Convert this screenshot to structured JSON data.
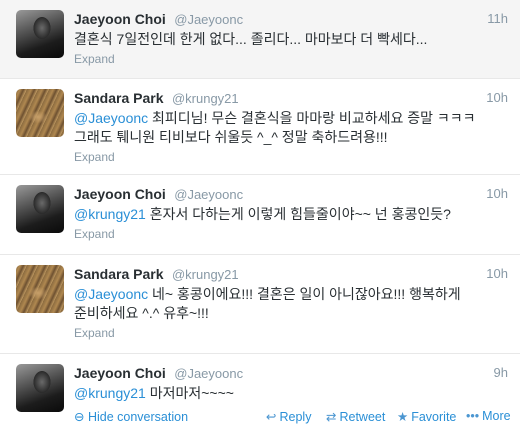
{
  "tweets": [
    {
      "name": "Jaeyoon Choi",
      "handle": "@Jaeyoonc",
      "time": "11h",
      "mention": "",
      "text": "결혼식 7일전인데 한게 없다... 졸리다... 마마보다 더 빡세다...",
      "expand": "Expand"
    },
    {
      "name": "Sandara Park",
      "handle": "@krungy21",
      "time": "10h",
      "mention": "@Jaeyoonc",
      "text": " 최피디님! 무슨 결혼식을 마마랑 비교하세요 증말 ㅋㅋㅋ 그래도 퉤니원 티비보다 쉬울듯 ^_^ 정말 축하드려용!!!",
      "expand": "Expand"
    },
    {
      "name": "Jaeyoon Choi",
      "handle": "@Jaeyoonc",
      "time": "10h",
      "mention": "@krungy21",
      "text": " 혼자서 다하는게 이렇게 힘들줄이야~~ 넌 홍콩인듯?",
      "expand": "Expand"
    },
    {
      "name": "Sandara Park",
      "handle": "@krungy21",
      "time": "10h",
      "mention": "@Jaeyoonc",
      "text": " 네~ 홍콩이에요!!! 결혼은 일이 아니잖아요!!! 행복하게 준비하세요 ^.^ 유후~!!!",
      "expand": "Expand"
    },
    {
      "name": "Jaeyoon Choi",
      "handle": "@Jaeyoonc",
      "time": "9h",
      "mention": "@krungy21",
      "text": " 마저마저~~~~",
      "hide_conversation": "Hide conversation",
      "reply": "Reply",
      "retweet": "Retweet",
      "favorite": "Favorite",
      "more": "More"
    }
  ],
  "icons": {
    "hide": "⊖",
    "reply": "↩",
    "retweet": "⇄",
    "favorite": "★",
    "more": "•••"
  },
  "colors": {
    "link": "#2a8fd6",
    "muted": "#8899a6",
    "selected_bg": "#f5f5f5"
  }
}
